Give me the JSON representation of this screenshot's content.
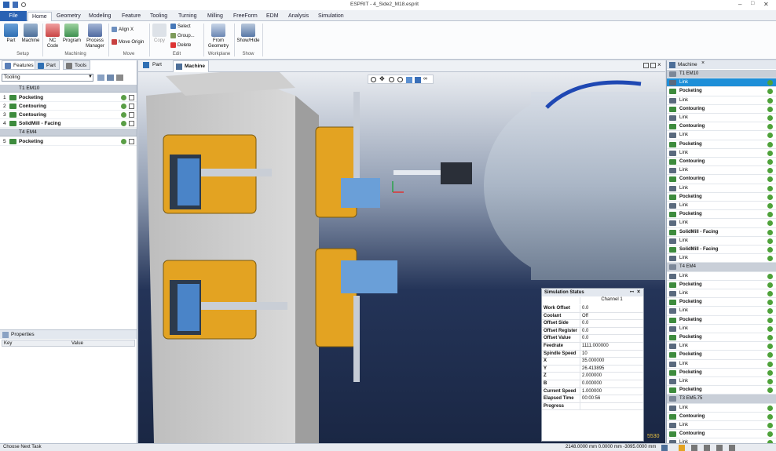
{
  "window": {
    "title": "ESPRIT - 4_Side2_M18.esprit"
  },
  "tabs": [
    "File",
    "Home",
    "Geometry",
    "Modeling",
    "Feature",
    "Tooling",
    "Turning",
    "Milling",
    "FreeForm",
    "EDM",
    "Analysis",
    "Simulation"
  ],
  "ribbon": {
    "setup": {
      "part": "Part",
      "machine": "Machine",
      "label": "Setup"
    },
    "machining": {
      "nc_code": "NC Code",
      "program": "Program",
      "process_manager": "Process Manager",
      "label": "Machining"
    },
    "move": {
      "align": "Align X",
      "move_origin": "Move Origin",
      "label": "Move"
    },
    "edit": {
      "copy": "Copy",
      "select": "Select",
      "group": "Group...",
      "delete": "Delete",
      "label": "Edit"
    },
    "workplane": {
      "from_geometry": "From Geometry",
      "label": "Workplane"
    },
    "show": {
      "show_hide": "Show/Hide",
      "label": "Show"
    }
  },
  "left_panel": {
    "tabs": [
      "Features",
      "Part",
      "Tools"
    ],
    "filter": "Tooling",
    "groups": [
      {
        "name": "T1  EM10",
        "ops": [
          {
            "num": "1",
            "name": "Pocketing"
          },
          {
            "num": "2",
            "name": "Contouring"
          },
          {
            "num": "3",
            "name": "Contouring"
          },
          {
            "num": "4",
            "name": "SolidMill - Facing"
          }
        ]
      },
      {
        "name": "T4  EM4",
        "ops": [
          {
            "num": "5",
            "name": "Pocketing"
          }
        ]
      }
    ]
  },
  "properties": {
    "title": "Properties",
    "col_key": "Key",
    "col_value": "Value"
  },
  "view_tabs": {
    "part": "Part",
    "machine": "Machine"
  },
  "machine_panel": {
    "title": "Machine",
    "rows": [
      {
        "t": "T1  EM10",
        "k": "g"
      },
      {
        "t": "Link",
        "k": "l",
        "sel": true
      },
      {
        "t": "Pocketing",
        "k": "o"
      },
      {
        "t": "Link",
        "k": "l"
      },
      {
        "t": "Contouring",
        "k": "o"
      },
      {
        "t": "Link",
        "k": "l"
      },
      {
        "t": "Contouring",
        "k": "o"
      },
      {
        "t": "Link",
        "k": "l"
      },
      {
        "t": "Pocketing",
        "k": "o"
      },
      {
        "t": "Link",
        "k": "l"
      },
      {
        "t": "Contouring",
        "k": "o"
      },
      {
        "t": "Link",
        "k": "l"
      },
      {
        "t": "Contouring",
        "k": "o"
      },
      {
        "t": "Link",
        "k": "l"
      },
      {
        "t": "Pocketing",
        "k": "o"
      },
      {
        "t": "Link",
        "k": "l"
      },
      {
        "t": "Pocketing",
        "k": "o"
      },
      {
        "t": "Link",
        "k": "l"
      },
      {
        "t": "SolidMill - Facing",
        "k": "o"
      },
      {
        "t": "Link",
        "k": "l"
      },
      {
        "t": "SolidMill - Facing",
        "k": "o"
      },
      {
        "t": "Link",
        "k": "l"
      },
      {
        "t": "T4  EM4",
        "k": "g"
      },
      {
        "t": "Link",
        "k": "l"
      },
      {
        "t": "Pocketing",
        "k": "o"
      },
      {
        "t": "Link",
        "k": "l"
      },
      {
        "t": "Pocketing",
        "k": "o"
      },
      {
        "t": "Link",
        "k": "l"
      },
      {
        "t": "Pocketing",
        "k": "o"
      },
      {
        "t": "Link",
        "k": "l"
      },
      {
        "t": "Pocketing",
        "k": "o"
      },
      {
        "t": "Link",
        "k": "l"
      },
      {
        "t": "Pocketing",
        "k": "o"
      },
      {
        "t": "Link",
        "k": "l"
      },
      {
        "t": "Pocketing",
        "k": "o"
      },
      {
        "t": "Link",
        "k": "l"
      },
      {
        "t": "Pocketing",
        "k": "o"
      },
      {
        "t": "T3  EM5.75",
        "k": "g"
      },
      {
        "t": "Link",
        "k": "l"
      },
      {
        "t": "Contouring",
        "k": "o"
      },
      {
        "t": "Link",
        "k": "l"
      },
      {
        "t": "Contouring",
        "k": "o"
      },
      {
        "t": "Link",
        "k": "l"
      }
    ]
  },
  "sim_status": {
    "title": "Simulation Status",
    "channel": "Channel 1",
    "rows": [
      {
        "k": "Work Offset",
        "v": "0.0"
      },
      {
        "k": "Coolant",
        "v": "Off"
      },
      {
        "k": "Offset Side",
        "v": "0.0"
      },
      {
        "k": "Offset Register",
        "v": "0.0"
      },
      {
        "k": "Offset Value",
        "v": "0.0"
      },
      {
        "k": "Feedrate",
        "v": "1111.000000"
      },
      {
        "k": "Spindle Speed",
        "v": "10"
      },
      {
        "k": "X",
        "v": "35.000000"
      },
      {
        "k": "Y",
        "v": "26.413895"
      },
      {
        "k": "Z",
        "v": "2.000000"
      },
      {
        "k": "B",
        "v": "0.000000"
      },
      {
        "k": "Current Speed",
        "v": "1.000000"
      },
      {
        "k": "Elapsed Time",
        "v": "00:00:56"
      },
      {
        "k": "Progress",
        "v": ""
      }
    ]
  },
  "statusbar": {
    "left": "Choose Next Task",
    "coords": "2148.0000 mm  0.0000 mm  -3095.0000 mm"
  },
  "viewport_readout": "5530",
  "colors": {
    "accent": "#2a62b3",
    "fixture": "#e3a322",
    "selection": "#1e8fd8"
  }
}
